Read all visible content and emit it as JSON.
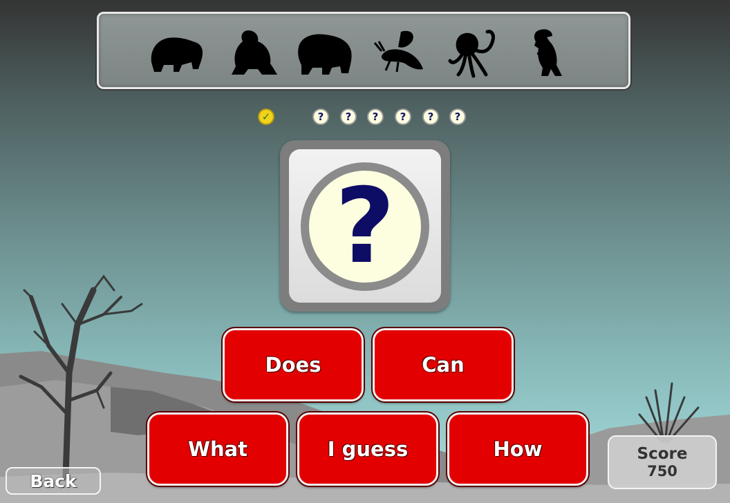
{
  "silhouettes": [
    {
      "icon": "bear-silhouette-icon"
    },
    {
      "icon": "gorilla-silhouette-icon"
    },
    {
      "icon": "polar-bear-silhouette-icon"
    },
    {
      "icon": "bee-silhouette-icon"
    },
    {
      "icon": "octopus-silhouette-icon"
    },
    {
      "icon": "dinosaur-silhouette-icon"
    }
  ],
  "progress": [
    {
      "state": "done",
      "glyph": "✓"
    },
    {
      "state": "unknown",
      "glyph": "?"
    },
    {
      "state": "unknown",
      "glyph": "?"
    },
    {
      "state": "unknown",
      "glyph": "?"
    },
    {
      "state": "unknown",
      "glyph": "?"
    },
    {
      "state": "unknown",
      "glyph": "?"
    }
  ],
  "card": {
    "glyph": "?"
  },
  "buttons": {
    "does": "Does",
    "can": "Can",
    "what": "What",
    "guess": "I guess",
    "how": "How"
  },
  "back_label": "Back",
  "score": {
    "label": "Score",
    "value": "750"
  },
  "colors": {
    "button": "#e30000",
    "card_mark": "#0d0d66",
    "check_dot": "#f1d21d"
  }
}
